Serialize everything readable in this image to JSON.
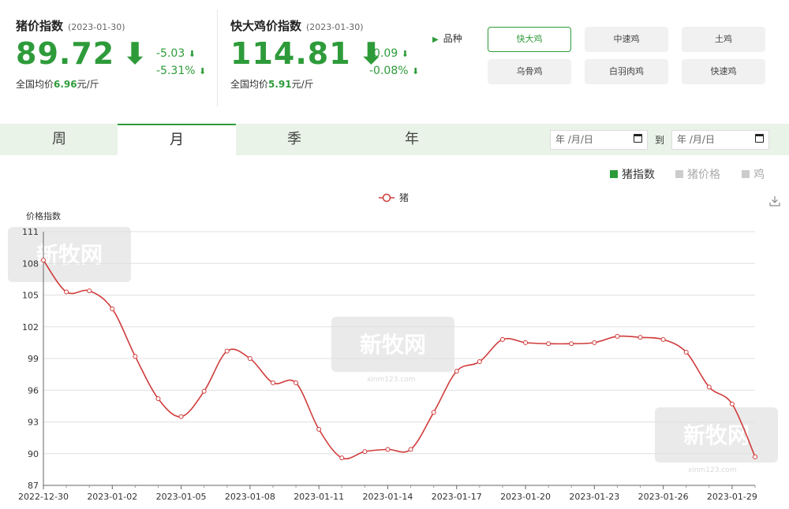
{
  "pig_card": {
    "title": "猪价指数",
    "date": "(2023-01-30)",
    "value": "89.72",
    "arrow": "⬇",
    "change_abs": "-5.03",
    "change_abs_arrow": "⬇",
    "change_pct": "-5.31%",
    "change_pct_arrow": "⬇",
    "avg_label": "全国均价",
    "avg_value": "6.96",
    "avg_unit": "元/斤"
  },
  "chicken_card": {
    "title": "快大鸡价指数",
    "date": "(2023-01-30)",
    "value": "114.81",
    "arrow": "⬇",
    "change_abs": "-0.09",
    "change_abs_arrow": "⬇",
    "change_pct": "-0.08%",
    "change_pct_arrow": "⬇",
    "avg_label": "全国均价",
    "avg_value": "5.91",
    "avg_unit": "元/斤"
  },
  "breeds": {
    "label": "品种",
    "items": [
      "快大鸡",
      "中速鸡",
      "土鸡",
      "乌骨鸡",
      "白羽肉鸡",
      "快速鸡"
    ],
    "selected": "快大鸡"
  },
  "tabs": [
    "周",
    "月",
    "季",
    "年"
  ],
  "active_tab": "月",
  "date_range": {
    "from_placeholder": "年 /月/日",
    "to_label": "到",
    "to_placeholder": "年 /月/日"
  },
  "top_legend": [
    {
      "label": "猪指数",
      "color": "#2e9b3a",
      "active": true
    },
    {
      "label": "猪价格",
      "color": "#cccccc",
      "active": false
    },
    {
      "label": "鸡",
      "color": "#cccccc",
      "active": false
    }
  ],
  "icons": {
    "download": "download-icon",
    "calendar": "calendar-icon"
  },
  "watermark": {
    "text": "新牧网",
    "sub": "xinm123.com"
  },
  "chart_data": {
    "type": "line",
    "ylabel": "价格指数",
    "ylim": [
      87,
      111
    ],
    "yticks": [
      87,
      90,
      93,
      96,
      99,
      102,
      105,
      108,
      111
    ],
    "xtick_labels": [
      "2022-12-30",
      "2023-01-02",
      "2023-01-05",
      "2023-01-08",
      "2023-01-11",
      "2023-01-14",
      "2023-01-17",
      "2023-01-20",
      "2023-01-23",
      "2023-01-26",
      "2023-01-29"
    ],
    "series": [
      {
        "name": "猪",
        "color": "#d03b3b",
        "x": [
          "2022-12-30",
          "2022-12-31",
          "2023-01-01",
          "2023-01-02",
          "2023-01-03",
          "2023-01-04",
          "2023-01-05",
          "2023-01-06",
          "2023-01-07",
          "2023-01-08",
          "2023-01-09",
          "2023-01-10",
          "2023-01-11",
          "2023-01-12",
          "2023-01-13",
          "2023-01-14",
          "2023-01-15",
          "2023-01-16",
          "2023-01-17",
          "2023-01-18",
          "2023-01-19",
          "2023-01-20",
          "2023-01-21",
          "2023-01-22",
          "2023-01-23",
          "2023-01-24",
          "2023-01-25",
          "2023-01-26",
          "2023-01-27",
          "2023-01-28",
          "2023-01-29",
          "2023-01-30"
        ],
        "values": [
          108.3,
          105.3,
          105.4,
          103.7,
          99.2,
          95.2,
          93.5,
          95.9,
          99.7,
          99.0,
          96.7,
          96.7,
          92.3,
          89.6,
          90.2,
          90.4,
          90.4,
          93.9,
          97.8,
          98.7,
          100.8,
          100.5,
          100.4,
          100.4,
          100.5,
          101.1,
          101.0,
          100.8,
          99.6,
          96.3,
          94.7,
          89.7
        ]
      }
    ],
    "grid": true,
    "legend_position": "top-center"
  }
}
